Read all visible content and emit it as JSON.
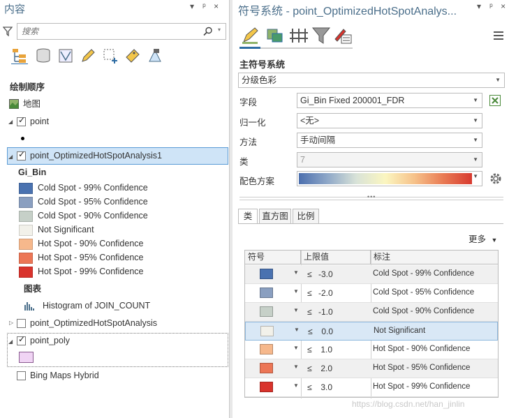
{
  "contents_pane": {
    "title": "内容",
    "controls": [
      "▾",
      "ᵖ",
      "×"
    ],
    "search_placeholder": "搜索",
    "section_title": "绘制顺序",
    "map_label": "地图",
    "layers": {
      "point": "point",
      "selected": "point_OptimizedHotSpotAnalysis1",
      "hotspot": "point_OptimizedHotSpotAnalysis",
      "poly": "point_poly",
      "basemap": "Bing Maps Hybrid"
    },
    "legend_field": "Gi_Bin",
    "legend": [
      {
        "label": "Cold Spot - 99% Confidence",
        "color": "#4a72b0"
      },
      {
        "label": "Cold Spot - 95% Confidence",
        "color": "#8a9fc0"
      },
      {
        "label": "Cold Spot - 90% Confidence",
        "color": "#c6d0c8"
      },
      {
        "label": "Not Significant",
        "color": "#f2f1ea"
      },
      {
        "label": "Hot Spot - 90% Confidence",
        "color": "#f6b88c"
      },
      {
        "label": "Hot Spot - 95% Confidence",
        "color": "#ec7656"
      },
      {
        "label": "Hot Spot - 99% Confidence",
        "color": "#d9332c"
      }
    ],
    "chart_heading": "图表",
    "chart_label": "Histogram of JOIN_COUNT",
    "poly_color": "#f0d4f4"
  },
  "symbology_pane": {
    "title": "符号系统 - point_OptimizedHotSpotAnalys...",
    "controls": [
      "▾",
      "ᵖ",
      "×"
    ],
    "primary_label": "主符号系统",
    "primary_value": "分级色彩",
    "field_label": "字段",
    "field_value": "Gi_Bin Fixed 200001_FDR",
    "normalization_label": "归一化",
    "normalization_value": "<无>",
    "method_label": "方法",
    "method_value": "手动间隔",
    "classes_label": "类",
    "classes_value": "7",
    "ramp_label": "配色方案",
    "tabs": [
      "类",
      "直方图",
      "比例"
    ],
    "more_label": "更多",
    "columns": [
      "符号",
      "上限值",
      "标注"
    ],
    "classes": [
      {
        "color": "#4a72b0",
        "upper": "-3.0",
        "label": "Cold Spot - 99% Confidence"
      },
      {
        "color": "#8a9fc0",
        "upper": "-2.0",
        "label": "Cold Spot - 95% Confidence"
      },
      {
        "color": "#c6d0c8",
        "upper": "-1.0",
        "label": "Cold Spot - 90% Confidence"
      },
      {
        "color": "#f2f1ea",
        "upper": "0.0",
        "label": "Not Significant"
      },
      {
        "color": "#f6b88c",
        "upper": "1.0",
        "label": "Hot Spot - 90% Confidence"
      },
      {
        "color": "#ec7656",
        "upper": "2.0",
        "label": "Hot Spot - 95% Confidence"
      },
      {
        "color": "#d9332c",
        "upper": "3.0",
        "label": "Hot Spot - 99% Confidence"
      }
    ],
    "le_symbol": "≤"
  },
  "watermark": "https://blog.csdn.net/han_jinlin"
}
